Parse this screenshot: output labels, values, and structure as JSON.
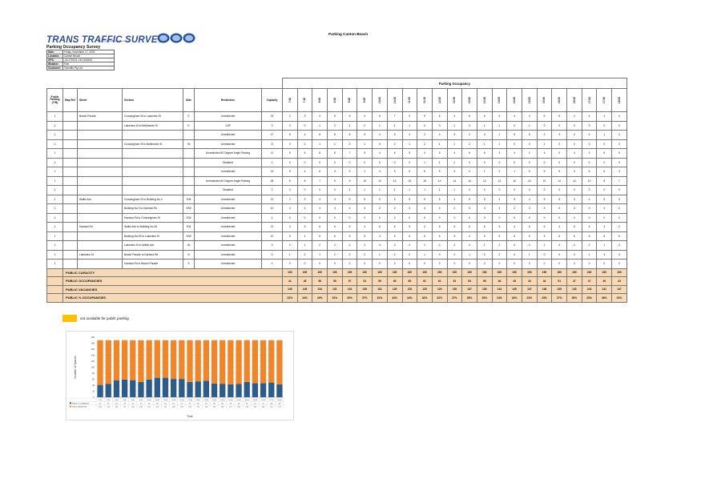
{
  "header": {
    "logo_text": "TRANS TRAFFIC SURVEY",
    "logo_sub": "www.transtrafficsurvey.com.au",
    "survey_title": "Parking Occupancy Survey",
    "page_title": "Parking Canton Beach"
  },
  "info": [
    {
      "key": "Date:",
      "value": "Friday, November 17, 2023"
    },
    {
      "key": "Location:",
      "value": "Canton Beach"
    },
    {
      "key": "GPS:",
      "value": "-33.275203, 151.543263"
    },
    {
      "key": "Weather:",
      "value": "Fine"
    },
    {
      "key": "Customer:",
      "value": "Tomoffin Pty Ltd"
    }
  ],
  "table": {
    "col_headers": {
      "public": "Public Parking (Y/N)",
      "mapref": "Map Ref",
      "street": "Street",
      "section": "Section",
      "side": "Side",
      "restriction": "Restriction",
      "capacity": "Capacity",
      "occupancy": "Parking Occupancy"
    },
    "times": [
      "7:00",
      "7:30",
      "8:00",
      "8:30",
      "9:00",
      "9:30",
      "10:00",
      "10:30",
      "11:00",
      "11:30",
      "12:00",
      "12:30",
      "13:00",
      "13:30",
      "14:00",
      "14:30",
      "15:00",
      "15:30",
      "16:00",
      "16:30",
      "17:00",
      "17:30",
      "18:00"
    ],
    "rows": [
      {
        "pub": "1",
        "ref": "",
        "street": "Beach Parade",
        "section": "Crossingham St to Lakeview St",
        "side": "E",
        "restr": "Unrestricted",
        "cap": "23",
        "vals": [
          "2",
          "3",
          "4",
          "5",
          "5",
          "4",
          "6",
          "7",
          "9",
          "9",
          "6",
          "4",
          "5",
          "6",
          "5",
          "4",
          "4",
          "6",
          "5",
          "4",
          "4",
          "4",
          "4"
        ]
      },
      {
        "pub": "1",
        "ref": "",
        "street": "",
        "section": "Lakeview St to Bellbowrie St",
        "side": "E",
        "restr": "1/4P",
        "cap": "3",
        "vals": [
          "0",
          "0",
          "1",
          "2",
          "1",
          "2",
          "1",
          "1",
          "1",
          "0",
          "0",
          "1",
          "0",
          "1",
          "1",
          "0",
          "1",
          "0",
          "0",
          "0",
          "0",
          "0",
          "0"
        ]
      },
      {
        "pub": "1",
        "ref": "",
        "street": "",
        "section": "",
        "side": "",
        "restr": "Unrestricted",
        "cap": "17",
        "vals": [
          "5",
          "4",
          "8",
          "8",
          "8",
          "5",
          "4",
          "5",
          "4",
          "2",
          "4",
          "5",
          "2",
          "4",
          "1",
          "5",
          "5",
          "2",
          "3",
          "2",
          "4",
          "1",
          "2"
        ]
      },
      {
        "pub": "1",
        "ref": "",
        "street": "",
        "section": "Crossingham St to Bellbowrie St",
        "side": "W",
        "restr": "Unrestricted",
        "cap": "8",
        "vals": [
          "0",
          "1",
          "1",
          "1",
          "3",
          "1",
          "3",
          "2",
          "1",
          "2",
          "1",
          "1",
          "2",
          "1",
          "1",
          "0",
          "0",
          "1",
          "0",
          "0",
          "0",
          "0",
          "0"
        ]
      },
      {
        "pub": "1",
        "ref": "",
        "street": "",
        "section": "",
        "side": "",
        "restr": "Unrestricted 60 Degree Angle Parking",
        "cap": "11",
        "vals": [
          "5",
          "6",
          "8",
          "8",
          "7",
          "5",
          "4",
          "6",
          "5",
          "4",
          "5",
          "4",
          "6",
          "6",
          "3",
          "4",
          "2",
          "4",
          "0",
          "4",
          "2",
          "6",
          "0"
        ]
      },
      {
        "pub": "1",
        "ref": "",
        "street": "",
        "section": "",
        "side": "",
        "restr": "Disabled",
        "cap": "1",
        "vals": [
          "0",
          "0",
          "0",
          "0",
          "0",
          "0",
          "0",
          "0",
          "0",
          "1",
          "1",
          "1",
          "0",
          "0",
          "0",
          "0",
          "0",
          "0",
          "0",
          "0",
          "0",
          "0",
          "0"
        ]
      },
      {
        "pub": "1",
        "ref": "",
        "street": "",
        "section": "",
        "side": "",
        "restr": "Unrestricted",
        "cap": "13",
        "vals": [
          "5",
          "4",
          "6",
          "3",
          "2",
          "1",
          "4",
          "5",
          "6",
          "6",
          "5",
          "4",
          "2",
          "1",
          "2",
          "1",
          "5",
          "5",
          "5",
          "4",
          "6",
          "6",
          "4"
        ]
      },
      {
        "pub": "1",
        "ref": "",
        "street": "",
        "section": "",
        "side": "",
        "restr": "Unrestricted 60 Degree Angle Parking",
        "cap": "28",
        "vals": [
          "6",
          "8",
          "7",
          "9",
          "9",
          "10",
          "12",
          "13",
          "15",
          "15",
          "14",
          "14",
          "14",
          "12",
          "12",
          "10",
          "10",
          "10",
          "12",
          "12",
          "10",
          "8",
          "7"
        ]
      },
      {
        "pub": "1",
        "ref": "",
        "street": "",
        "section": "",
        "side": "",
        "restr": "Disabled",
        "cap": "2",
        "vals": [
          "0",
          "0",
          "0",
          "0",
          "1",
          "1",
          "1",
          "1",
          "1",
          "1",
          "1",
          "1",
          "0",
          "0",
          "0",
          "0",
          "0",
          "0",
          "0",
          "0",
          "0",
          "0",
          "0"
        ]
      },
      {
        "pub": "1",
        "ref": "",
        "street": "Wallis Ave",
        "section": "Crossingham St to Building No.4",
        "side": "E/N",
        "restr": "Unrestricted",
        "cap": "13",
        "vals": [
          "2",
          "3",
          "4",
          "3",
          "5",
          "5",
          "5",
          "5",
          "5",
          "5",
          "5",
          "4",
          "5",
          "5",
          "4",
          "5",
          "4",
          "5",
          "5",
          "5",
          "4",
          "5",
          "5"
        ]
      },
      {
        "pub": "1",
        "ref": "",
        "street": "",
        "section": "Building No.3 to Kantara Rd",
        "side": "S/W",
        "restr": "Unrestricted",
        "cap": "10",
        "vals": [
          "4",
          "4",
          "4",
          "4",
          "4",
          "4",
          "2",
          "2",
          "3",
          "4",
          "4",
          "2",
          "3",
          "3",
          "4",
          "2",
          "3",
          "3",
          "3",
          "3",
          "3",
          "4",
          "2"
        ]
      },
      {
        "pub": "1",
        "ref": "",
        "street": "",
        "section": "Kantara Rd to Crossingham St",
        "side": "S/W",
        "restr": "Unrestricted",
        "cap": "4",
        "vals": [
          "0",
          "0",
          "0",
          "0",
          "0",
          "0",
          "0",
          "0",
          "0",
          "0",
          "0",
          "0",
          "0",
          "0",
          "0",
          "0",
          "0",
          "0",
          "0",
          "0",
          "0",
          "0",
          "0"
        ]
      },
      {
        "pub": "1",
        "ref": "",
        "street": "Kantara Rd",
        "section": "Wallis Ave to Building No.26",
        "side": "E/N",
        "restr": "Unrestricted",
        "cap": "21",
        "vals": [
          "4",
          "5",
          "6",
          "6",
          "5",
          "4",
          "6",
          "6",
          "5",
          "4",
          "5",
          "6",
          "6",
          "6",
          "5",
          "4",
          "5",
          "5",
          "4",
          "5",
          "4",
          "3",
          "2"
        ]
      },
      {
        "pub": "1",
        "ref": "",
        "street": "",
        "section": "Building No.25 to Lakeview St",
        "side": "S/W",
        "restr": "Unrestricted",
        "cap": "12",
        "vals": [
          "5",
          "4",
          "6",
          "6",
          "6",
          "5",
          "4",
          "5",
          "6",
          "6",
          "6",
          "5",
          "4",
          "5",
          "5",
          "6",
          "5",
          "4",
          "6",
          "6",
          "6",
          "6",
          "6"
        ]
      },
      {
        "pub": "1",
        "ref": "",
        "street": "",
        "section": "Lakeview St to Wallis Ave",
        "side": "W",
        "restr": "Unrestricted",
        "cap": "9",
        "vals": [
          "2",
          "1",
          "2",
          "2",
          "2",
          "3",
          "3",
          "3",
          "2",
          "1",
          "2",
          "2",
          "2",
          "1",
          "2",
          "2",
          "2",
          "1",
          "2",
          "2",
          "2",
          "1",
          "2"
        ]
      },
      {
        "pub": "1",
        "ref": "",
        "street": "Lakeview St",
        "section": "Beach Parade to Kantara Rd",
        "side": "N",
        "restr": "Unrestricted",
        "cap": "5",
        "vals": [
          "1",
          "2",
          "1",
          "2",
          "2",
          "2",
          "1",
          "2",
          "2",
          "1",
          "0",
          "0",
          "1",
          "2",
          "2",
          "0",
          "1",
          "0",
          "0",
          "0",
          "1",
          "3",
          "4"
        ]
      },
      {
        "pub": "1",
        "ref": "",
        "street": "",
        "section": "Kantara Rd to Beach Parade",
        "side": "S",
        "restr": "Unrestricted",
        "cap": "4",
        "vals": [
          "0",
          "0",
          "0",
          "0",
          "0",
          "0",
          "0",
          "0",
          "0",
          "0",
          "0",
          "0",
          "0",
          "0",
          "0",
          "0",
          "0",
          "0",
          "0",
          "0",
          "0",
          "0",
          "0"
        ]
      }
    ],
    "summary": [
      {
        "label": "PUBLIC  CAPACITY",
        "vals": [
          "190",
          "190",
          "190",
          "190",
          "190",
          "190",
          "190",
          "190",
          "190",
          "190",
          "190",
          "190",
          "190",
          "190",
          "190",
          "190",
          "190",
          "190",
          "190",
          "190",
          "190",
          "190",
          "190"
        ]
      },
      {
        "label": "PUBLIC OCCUPANCIES",
        "vals": [
          "41",
          "45",
          "56",
          "59",
          "57",
          "51",
          "59",
          "65",
          "65",
          "61",
          "61",
          "51",
          "53",
          "55",
          "46",
          "45",
          "43",
          "44",
          "51",
          "47",
          "47",
          "49",
          "43"
        ]
      },
      {
        "label": "PUBLIC  VACANCIES",
        "vals": [
          "149",
          "145",
          "134",
          "131",
          "133",
          "139",
          "131",
          "125",
          "125",
          "129",
          "129",
          "139",
          "137",
          "135",
          "144",
          "145",
          "147",
          "146",
          "139",
          "143",
          "143",
          "141",
          "147"
        ]
      },
      {
        "label": "PUBLIC  % OCCUPANCIES",
        "vals": [
          "22%",
          "24%",
          "29%",
          "31%",
          "30%",
          "27%",
          "31%",
          "34%",
          "34%",
          "32%",
          "32%",
          "27%",
          "28%",
          "29%",
          "24%",
          "24%",
          "23%",
          "23%",
          "27%",
          "25%",
          "25%",
          "26%",
          "23%"
        ]
      }
    ]
  },
  "legend": {
    "text": "not available for public parking",
    "color": "#ffc000"
  },
  "chart_data": {
    "type": "bar",
    "stacked": true,
    "title": "",
    "xlabel": "Time",
    "ylabel": "Number of Spaces",
    "ylim": [
      0,
      200
    ],
    "yticks": [
      0,
      20,
      40,
      60,
      80,
      100,
      120,
      140,
      160,
      180,
      200
    ],
    "grid": true,
    "categories": [
      "7:00",
      "7:30",
      "8:00",
      "8:30",
      "9:00",
      "9:30",
      "10:00",
      "10:30",
      "11:00",
      "11:30",
      "12:00",
      "12:30",
      "13:00",
      "13:30",
      "14:00",
      "14:30",
      "15:00",
      "15:30",
      "16:00",
      "16:30",
      "17:00",
      "17:30",
      "18:00"
    ],
    "series": [
      {
        "name": "PUBLIC OCCUPANCIES",
        "color": "#2e5c8a",
        "values": [
          41,
          45,
          56,
          59,
          57,
          51,
          59,
          65,
          65,
          61,
          61,
          51,
          53,
          55,
          46,
          45,
          43,
          44,
          51,
          47,
          47,
          49,
          43
        ]
      },
      {
        "name": "PUBLIC VACANCIES",
        "color": "#f0862a",
        "values": [
          149,
          145,
          134,
          131,
          133,
          139,
          131,
          125,
          125,
          129,
          129,
          139,
          137,
          135,
          144,
          145,
          147,
          146,
          139,
          143,
          143,
          141,
          147
        ]
      }
    ]
  }
}
